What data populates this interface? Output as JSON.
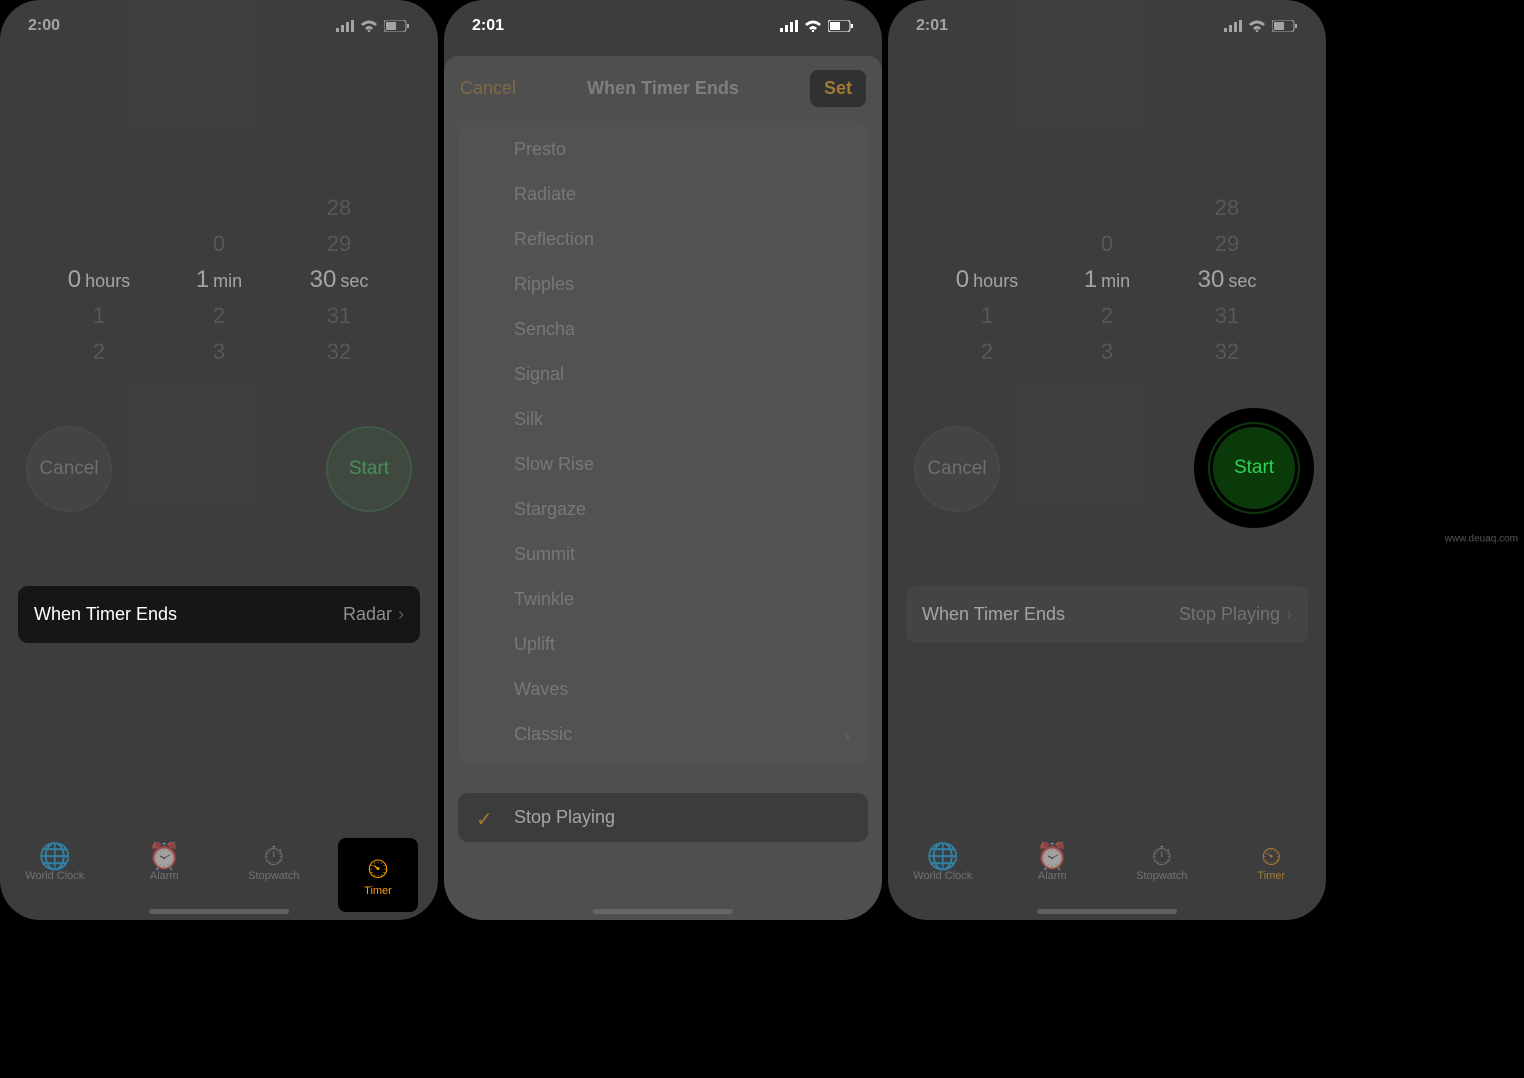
{
  "status": {
    "time_a": "2:00",
    "time_b": "2:01",
    "time_c": "2:01"
  },
  "picker": {
    "hours_label": "hours",
    "min_label": "min",
    "sec_label": "sec",
    "hours_sel": "0",
    "min_sel": "1",
    "sec_sel": "30",
    "hours_above": "",
    "min_above": "0",
    "sec_above_2": "28",
    "sec_above_1": "29",
    "hours_below_1": "1",
    "hours_below_2": "2",
    "min_below_1": "2",
    "min_below_2": "3",
    "sec_below_1": "31",
    "sec_below_2": "32"
  },
  "buttons": {
    "cancel": "Cancel",
    "start": "Start"
  },
  "row": {
    "label": "When Timer Ends",
    "value_a": "Radar",
    "value_c": "Stop Playing"
  },
  "tabs": {
    "world_clock": "World Clock",
    "alarm": "Alarm",
    "stopwatch": "Stopwatch",
    "timer": "Timer"
  },
  "sheet": {
    "cancel": "Cancel",
    "title": "When Timer Ends",
    "set": "Set",
    "sounds": [
      "Presto",
      "Radiate",
      "Reflection",
      "Ripples",
      "Sencha",
      "Signal",
      "Silk",
      "Slow Rise",
      "Stargaze",
      "Summit",
      "Twinkle",
      "Uplift",
      "Waves",
      "Classic"
    ],
    "stop_playing": "Stop Playing"
  },
  "watermark": "www.deuaq.com"
}
